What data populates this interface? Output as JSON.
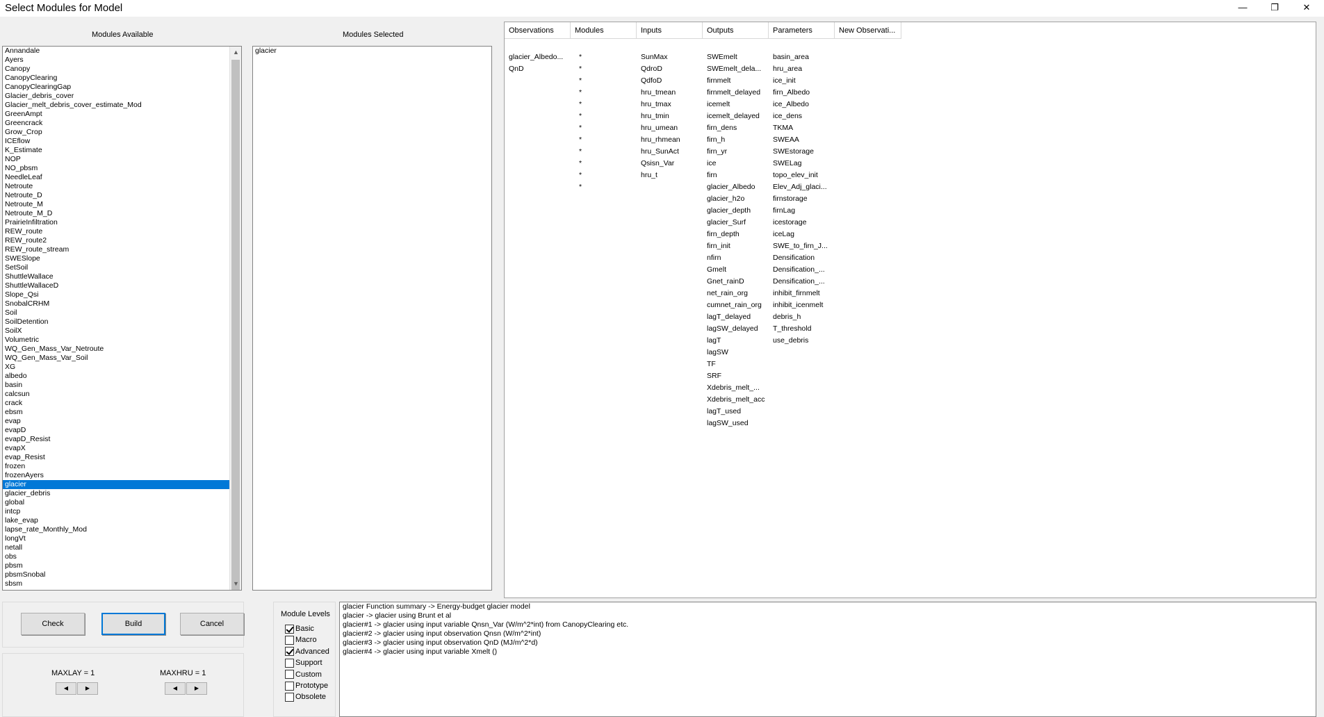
{
  "window": {
    "title": "Select Modules for Model",
    "minimize": "—",
    "restore": "❐",
    "close": "✕"
  },
  "modules_available": {
    "header": "Modules Available",
    "items": [
      "Annandale",
      "Ayers",
      "Canopy",
      "CanopyClearing",
      "CanopyClearingGap",
      "Glacier_debris_cover",
      "Glacier_melt_debris_cover_estimate_Mod",
      "GreenAmpt",
      "Greencrack",
      "Grow_Crop",
      "ICEflow",
      "K_Estimate",
      "NOP",
      "NO_pbsm",
      "NeedleLeaf",
      "Netroute",
      "Netroute_D",
      "Netroute_M",
      "Netroute_M_D",
      "PrairieInfiltration",
      "REW_route",
      "REW_route2",
      "REW_route_stream",
      "SWESlope",
      "SetSoil",
      "ShuttleWallace",
      "ShuttleWallaceD",
      "Slope_Qsi",
      "SnobalCRHM",
      "Soil",
      "SoilDetention",
      "SoilX",
      "Volumetric",
      "WQ_Gen_Mass_Var_Netroute",
      "WQ_Gen_Mass_Var_Soil",
      "XG",
      "albedo",
      "basin",
      "calcsun",
      "crack",
      "ebsm",
      "evap",
      "evapD",
      "evapD_Resist",
      "evapX",
      "evap_Resist",
      "frozen",
      "frozenAyers",
      "glacier",
      "glacier_debris",
      "global",
      "intcp",
      "lake_evap",
      "lapse_rate_Monthly_Mod",
      "longVt",
      "netall",
      "obs",
      "pbsm",
      "pbsmSnobal",
      "sbsm"
    ],
    "selected": "glacier"
  },
  "modules_selected": {
    "header": "Modules Selected",
    "items": [
      "glacier"
    ]
  },
  "details": {
    "columns": {
      "observations": "Observations",
      "modules": "Modules",
      "inputs": "Inputs",
      "outputs": "Outputs",
      "parameters": "Parameters",
      "new_observations": "New Observati..."
    },
    "observations": [
      "glacier_Albedo...",
      "QnD"
    ],
    "modules": [
      "*",
      "*",
      "*",
      "*",
      "*",
      "*",
      "*",
      "*",
      "*",
      "*",
      "*",
      "*"
    ],
    "inputs": [
      "SunMax",
      "QdroD",
      "QdfoD",
      "hru_tmean",
      "hru_tmax",
      "hru_tmin",
      "hru_umean",
      "hru_rhmean",
      "hru_SunAct",
      "Qsisn_Var",
      "hru_t"
    ],
    "outputs": [
      "SWEmelt",
      "SWEmelt_dela...",
      "firnmelt",
      "firnmelt_delayed",
      "icemelt",
      "icemelt_delayed",
      "firn_dens",
      "firn_h",
      "firn_yr",
      "ice",
      "firn",
      "glacier_Albedo",
      "glacier_h2o",
      "glacier_depth",
      "glacier_Surf",
      "firn_depth",
      "firn_init",
      "nfirn",
      "Gmelt",
      "Gnet_rainD",
      "net_rain_org",
      "cumnet_rain_org",
      "lagT_delayed",
      "lagSW_delayed",
      "lagT",
      "lagSW",
      "TF",
      "SRF",
      "Xdebris_melt_...",
      "Xdebris_melt_acc",
      "lagT_used",
      "lagSW_used"
    ],
    "parameters": [
      "basin_area",
      "hru_area",
      "ice_init",
      "firn_Albedo",
      "ice_Albedo",
      "ice_dens",
      "TKMA",
      "SWEAA",
      "SWEstorage",
      "SWELag",
      "topo_elev_init",
      "Elev_Adj_glaci...",
      "firnstorage",
      "firnLag",
      "icestorage",
      "iceLag",
      "SWE_to_firn_J...",
      "Densification",
      "Densification_...",
      "Densification_...",
      "inhibit_firnmelt",
      "inhibit_icenmelt",
      "debris_h",
      "T_threshold",
      "use_debris"
    ]
  },
  "buttons": {
    "check": "Check",
    "build": "Build",
    "cancel": "Cancel"
  },
  "max": {
    "maxlay": "MAXLAY =  1",
    "maxhru": "MAXHRU = 1"
  },
  "module_levels": {
    "title": "Module Levels",
    "items": [
      {
        "label": "Basic",
        "checked": true
      },
      {
        "label": "Macro",
        "checked": false
      },
      {
        "label": "Advanced",
        "checked": true
      },
      {
        "label": "Support",
        "checked": false
      },
      {
        "label": "Custom",
        "checked": false
      },
      {
        "label": "Prototype",
        "checked": false
      },
      {
        "label": "Obsolete",
        "checked": false
      }
    ]
  },
  "info_lines": [
    "glacier Function summary -> Energy-budget glacier model",
    "glacier   -> glacier using Brunt et al",
    "glacier#1 -> glacier using input variable Qnsn_Var (W/m^2*int) from CanopyClearing etc.",
    "glacier#2 -> glacier using input observation Qnsn (W/m^2*int)",
    "glacier#3 -> glacier using input observation QnD (MJ/m^2*d)",
    "glacier#4 -> glacier using input variable Xmelt ()"
  ],
  "colors": {
    "selection": "#0078d7",
    "window_bg": "#f0f0f0"
  }
}
